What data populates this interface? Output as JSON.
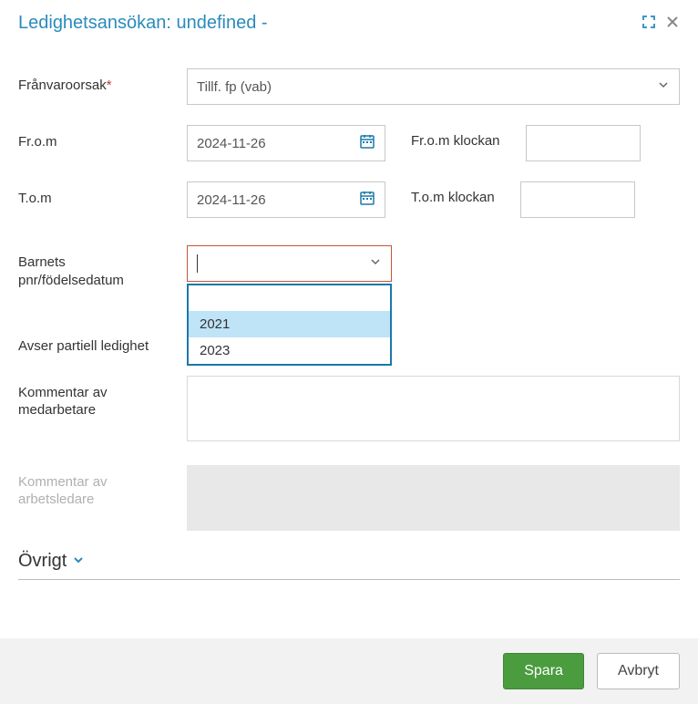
{
  "header": {
    "title": "Ledighetsansökan: undefined -"
  },
  "fields": {
    "reason": {
      "label": "Frånvaroorsak",
      "required": "*",
      "value": "Tillf. fp (vab)"
    },
    "from_date": {
      "label": "Fr.o.m",
      "value": "2024-11-26"
    },
    "from_time": {
      "label": "Fr.o.m klockan",
      "value": ""
    },
    "to_date": {
      "label": "T.o.m",
      "value": "2024-11-26"
    },
    "to_time": {
      "label": "T.o.m klockan",
      "value": ""
    },
    "child": {
      "label": "Barnets pnr/födelsedatum",
      "value": ""
    },
    "partial": {
      "label": "Avser partiell ledighet"
    },
    "comment_emp": {
      "label": "Kommentar av medarbetare",
      "value": ""
    },
    "comment_mgr": {
      "label": "Kommentar av arbetsledare"
    }
  },
  "dropdown": {
    "options": [
      "",
      "2021",
      "2023"
    ],
    "highlighted": "2021"
  },
  "collapse": {
    "label": "Övrigt"
  },
  "footer": {
    "save": "Spara",
    "cancel": "Avbryt"
  }
}
